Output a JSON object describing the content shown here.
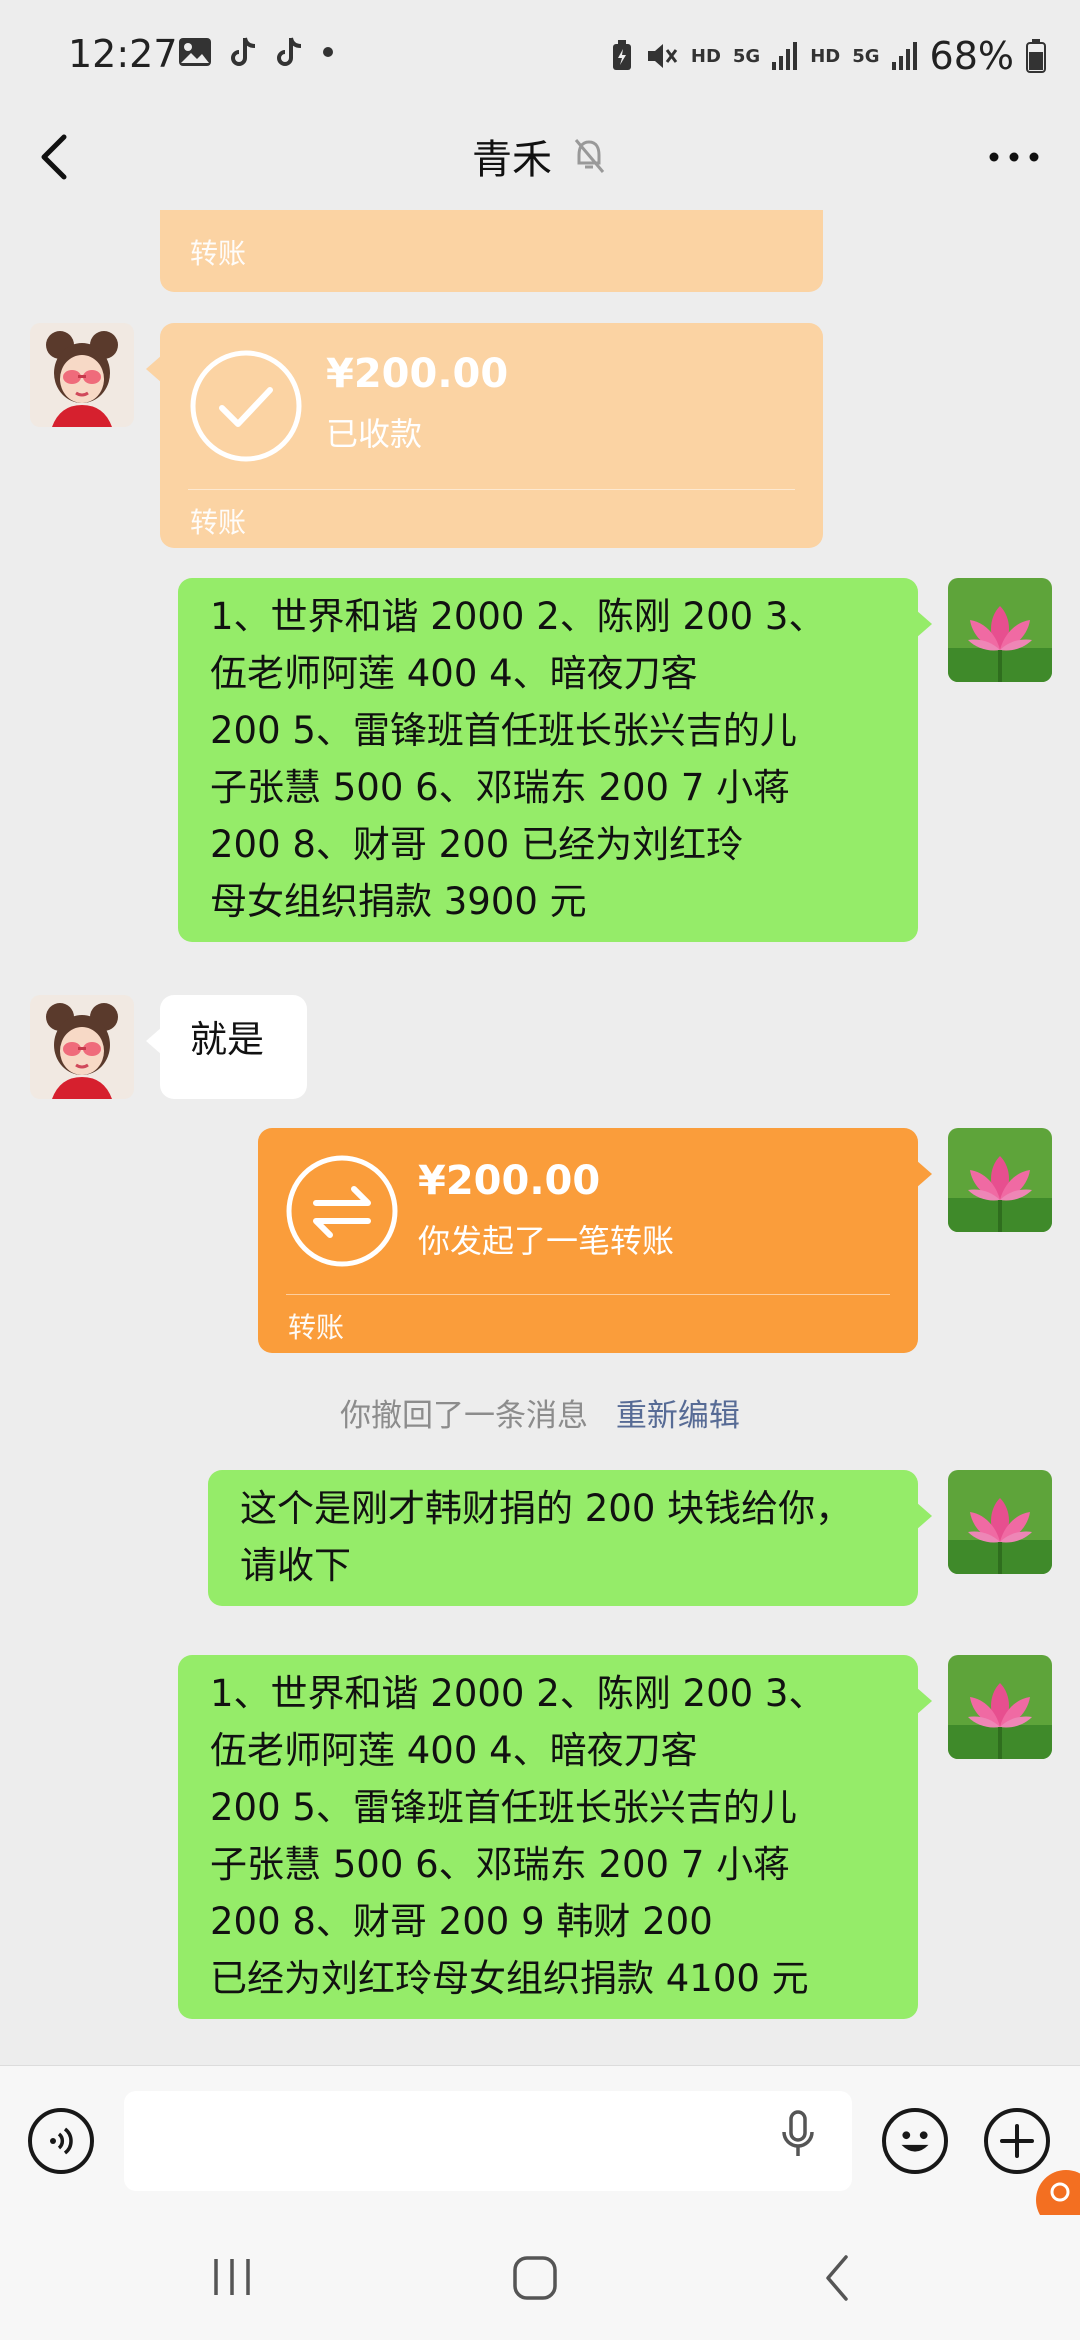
{
  "status_bar": {
    "time": "12:27",
    "hd1": "HD",
    "net1": "5G",
    "hd2": "HD",
    "net2": "5G",
    "battery": "68%"
  },
  "header": {
    "title": "青禾",
    "back_icon": "chevron-left-icon",
    "mute_icon": "bell-off-icon",
    "more_icon": "ellipsis-icon"
  },
  "messages": {
    "m0_transfer_label": "转账",
    "m1_amount": "¥200.00",
    "m1_status": "已收款",
    "m1_label": "转账",
    "m2_lines": [
      "1、世界和谐 2000   2、陈刚 200   3、",
      "伍老师阿莲   400     4、暗夜刀客",
      "200   5、雷锋班首任班长张兴吉的儿",
      "子张慧 500   6、邓瑞东 200   7  小蒋",
      "200       8、财哥 200    已经为刘红玲",
      "母女组织捐款 3900 元"
    ],
    "m3_text": "就是",
    "m4_amount": "¥200.00",
    "m4_status": "你发起了一笔转账",
    "m4_label": "转账",
    "sys_text": "你撤回了一条消息",
    "sys_link": "重新编辑",
    "m5_lines": [
      "这个是刚才韩财捐的 200 块钱给你，",
      "请收下"
    ],
    "m6_lines": [
      "1、世界和谐 2000   2、陈刚 200   3、",
      "伍老师阿莲   400     4、暗夜刀客",
      "200   5、雷锋班首任班长张兴吉的儿",
      "子张慧 500   6、邓瑞东 200   7  小蒋",
      "200       8、财哥 200     9 韩财  200",
      "已经为刘红玲母女组织捐款 4100 元"
    ]
  },
  "input_bar": {
    "voice_icon": "voice-icon",
    "emoji_icon": "emoji-icon",
    "plus_icon": "plus-icon",
    "mic_icon": "microphone-icon",
    "value": ""
  },
  "colors": {
    "background": "#ededed",
    "self_bubble": "#95ec69",
    "other_bubble": "#ffffff",
    "transfer_received": "#fbd3a3",
    "transfer_sent": "#fa9d3b",
    "link": "#576b95"
  }
}
